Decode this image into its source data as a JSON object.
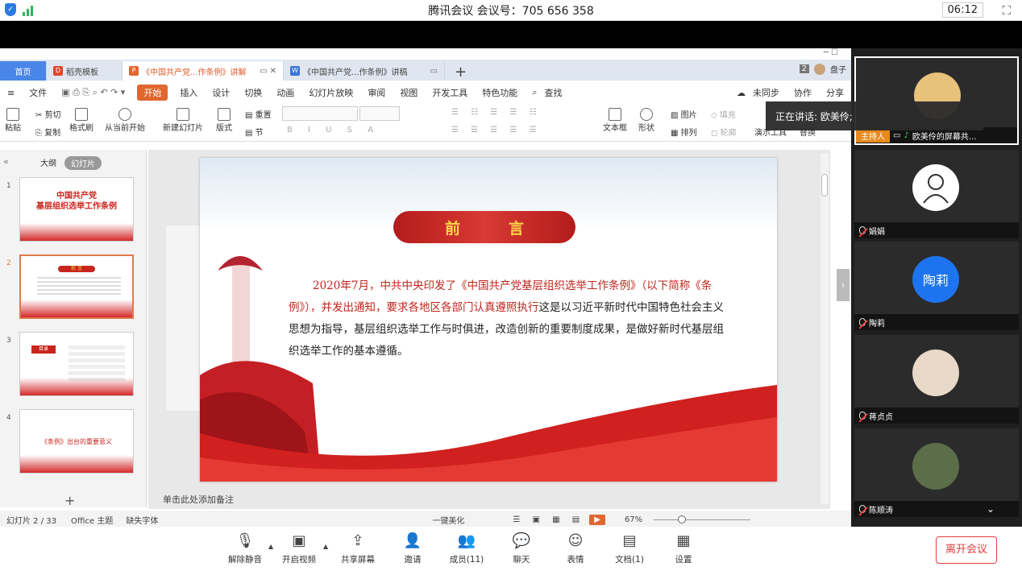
{
  "meeting": {
    "title": "腾讯会议 会议号：705 656 358",
    "timer": "06:12"
  },
  "wps": {
    "tabs": [
      {
        "label": "首页"
      },
      {
        "label": "稻壳模板"
      },
      {
        "label": "《中国共产党...作条例》讲解"
      },
      {
        "label": "《中国共产党...作条例》讲稿"
      }
    ],
    "tab_count": "2",
    "user_name": "盘子",
    "menu": [
      "文件",
      "开始",
      "插入",
      "设计",
      "切换",
      "动画",
      "幻灯片放映",
      "审阅",
      "视图",
      "开发工具",
      "特色功能",
      "查找"
    ],
    "menu_right": [
      "未同步",
      "协作",
      "分享"
    ],
    "ribbon": {
      "paste": "粘贴",
      "cut": "剪切",
      "copy": "复制",
      "format_painter": "格式刷",
      "from_current": "从当前开始",
      "new_slide": "新建幻灯片",
      "layout": "版式",
      "reset": "重置",
      "section": "节",
      "textbox": "文本框",
      "shape": "形状",
      "picture": "图片",
      "arrange": "排列",
      "fill": "填充",
      "outline": "轮廓",
      "presenter": "演示工具",
      "replace": "替换"
    },
    "pane_tabs": [
      "大纲",
      "幻灯片"
    ],
    "thumbs": [
      {
        "num": "1",
        "title": "中国共产党\n基层组织选举工作条例"
      },
      {
        "num": "2",
        "title": "前 言"
      },
      {
        "num": "3",
        "title": "目录"
      },
      {
        "num": "4",
        "title": "《条例》出台的重要意义"
      }
    ],
    "slide": {
      "header": "前言",
      "body_red": "2020年7月，中共中央印发了《中国共产党基层组织选举工作条例》（以下简称《条例》），并发出通知，要求各地区各部门认真遵照执行",
      "body_rest": "这是以习近平新时代中国特色社会主义思想为指导，基层组织选举工作与时俱进，改造创新的重要制度成果，是做好新时代基层组织选举工作的基本遵循。"
    },
    "notes_placeholder": "单击此处添加备注",
    "status": {
      "slide_info": "幻灯片 2 / 33",
      "theme": "Office 主题",
      "missing_font": "缺失字体",
      "beautify": "一键美化",
      "zoom": "67%"
    }
  },
  "participants": {
    "speaking": "正在讲话: 欧美伶;",
    "list": [
      {
        "name": "欧美伶的屏幕共...",
        "role": "主持人"
      },
      {
        "name": "娟娟"
      },
      {
        "name": "陶莉",
        "avatar_text": "陶莉"
      },
      {
        "name": "蒋贞贞"
      },
      {
        "name": "陈顺涛"
      }
    ]
  },
  "toolbar": [
    {
      "label": "解除静音"
    },
    {
      "label": "开启视频"
    },
    {
      "label": "共享屏幕"
    },
    {
      "label": "邀请"
    },
    {
      "label": "成员(11)"
    },
    {
      "label": "聊天"
    },
    {
      "label": "表情"
    },
    {
      "label": "文档(1)"
    },
    {
      "label": "设置"
    }
  ],
  "leave_label": "离开会议",
  "colors": {
    "accent": "#e0672e",
    "slide_red": "#c0241c",
    "leave": "#e04040",
    "meeting_bg": "#1f1f1f"
  }
}
